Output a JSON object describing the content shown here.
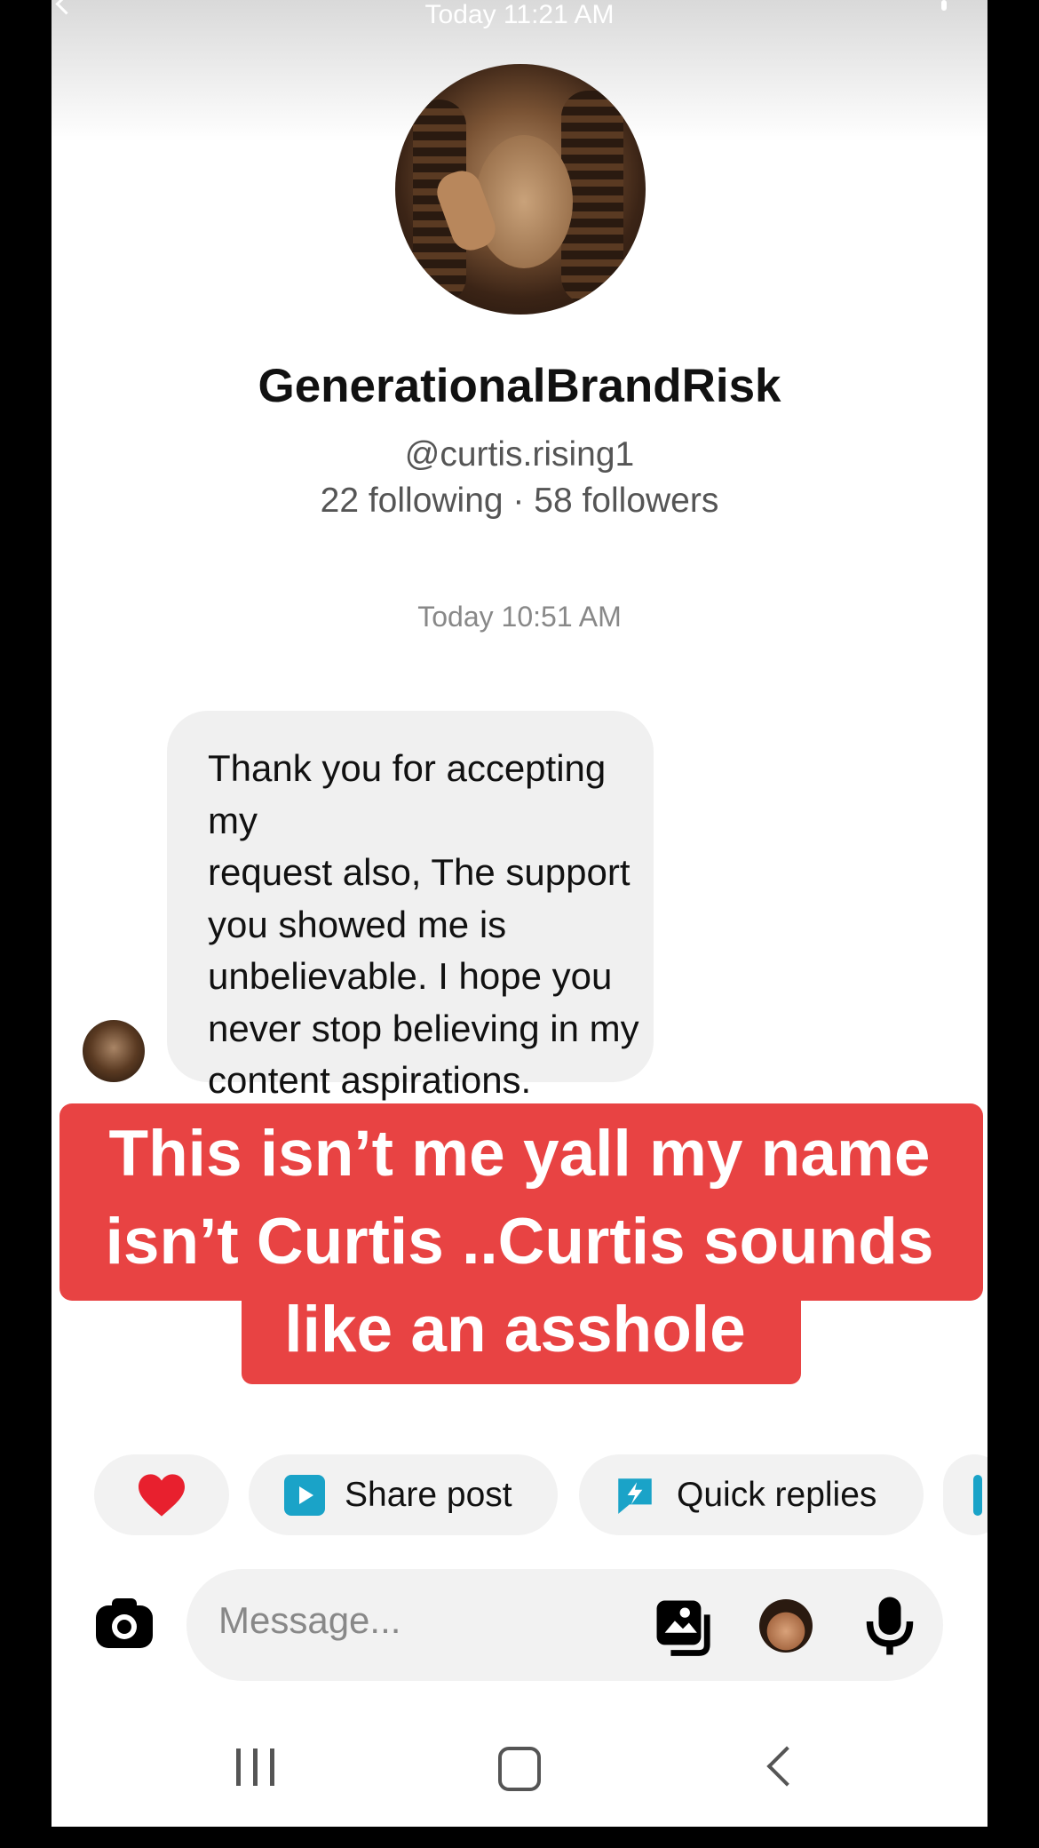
{
  "status_bar": {
    "time": "Today 11:21 AM"
  },
  "profile": {
    "display_name": "GenerationalBrandRisk",
    "handle": "@curtis.rising1",
    "stats": "22 following · 58 followers"
  },
  "thread": {
    "timestamp": "Today 10:51 AM",
    "message_lines": [
      "Thank you for accepting my",
      "request also, The support",
      "you showed me is",
      "unbelievable. I hope you",
      "never stop believing in my",
      "content aspirations."
    ]
  },
  "caption_overlay": {
    "lines": [
      "This isn’t me yall my name",
      "isn’t Curtis ..Curtis sounds",
      "like an asshole"
    ],
    "color": "#e84343"
  },
  "quick_actions": {
    "share_label": "Share post",
    "quick_replies_label": "Quick replies",
    "heart_color": "#e8202e",
    "accent_color": "#1aa3c8"
  },
  "composer": {
    "placeholder": "Message..."
  },
  "icons": [
    "heart-icon",
    "share-post-icon",
    "quick-replies-icon",
    "camera-icon",
    "gallery-icon",
    "sticker-icon",
    "mic-icon",
    "nav-recents-icon",
    "nav-home-icon",
    "nav-back-icon"
  ]
}
